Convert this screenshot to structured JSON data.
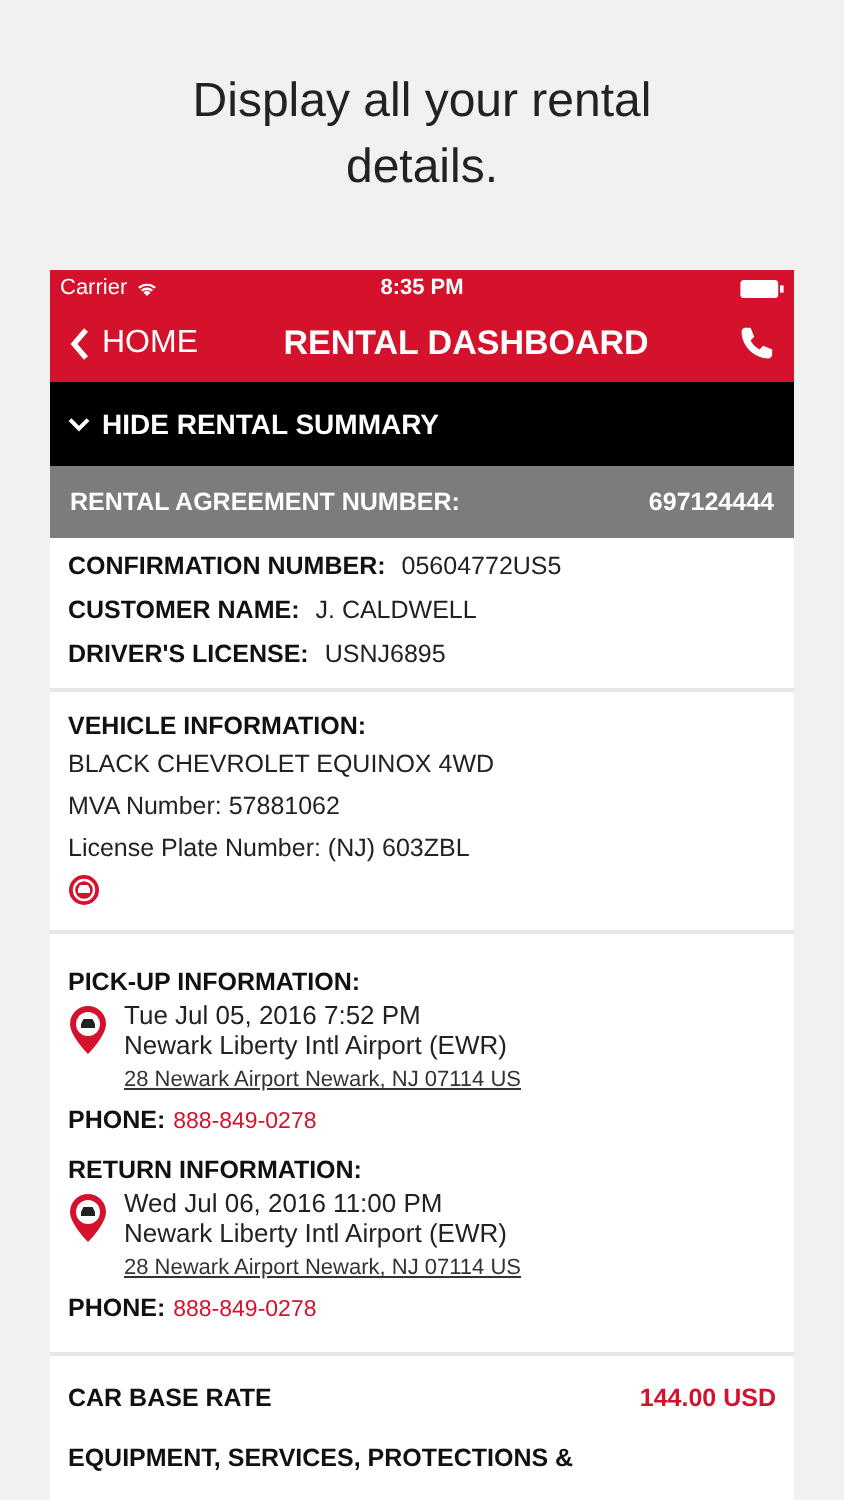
{
  "caption": "Display all your rental details.",
  "status_bar": {
    "carrier": "Carrier",
    "time": "8:35 PM"
  },
  "nav": {
    "back_label": "HOME",
    "title": "RENTAL DASHBOARD"
  },
  "summary_toggle": {
    "label": "HIDE RENTAL SUMMARY",
    "expanded": true
  },
  "agreement": {
    "label": "RENTAL AGREEMENT NUMBER:",
    "value": "697124444"
  },
  "customer_fields": [
    {
      "label": "CONFIRMATION NUMBER:",
      "value": "05604772US5"
    },
    {
      "label": "CUSTOMER NAME:",
      "value": "J. CALDWELL"
    },
    {
      "label": "DRIVER'S LICENSE:",
      "value": "USNJ6895"
    }
  ],
  "vehicle": {
    "heading": "VEHICLE INFORMATION:",
    "lines": [
      "BLACK CHEVROLET EQUINOX 4WD",
      "MVA Number: 57881062",
      "License Plate Number: (NJ) 603ZBL"
    ]
  },
  "locations": [
    {
      "heading": "PICK-UP INFORMATION:",
      "datetime": "Tue Jul 05, 2016 7:52 PM",
      "place": "Newark Liberty Intl Airport (EWR)",
      "address": "28 Newark Airport Newark, NJ 07114 US",
      "phone_label": "PHONE:",
      "phone": "888-849-0278"
    },
    {
      "heading": "RETURN INFORMATION:",
      "datetime": "Wed Jul 06, 2016 11:00 PM",
      "place": "Newark Liberty Intl Airport (EWR)",
      "address": "28 Newark Airport Newark, NJ 07114 US",
      "phone_label": "PHONE:",
      "phone": "888-849-0278"
    }
  ],
  "rates": [
    {
      "label": "CAR BASE RATE",
      "value": "144.00 USD"
    },
    {
      "label": "EQUIPMENT, SERVICES, PROTECTIONS &"
    }
  ]
}
